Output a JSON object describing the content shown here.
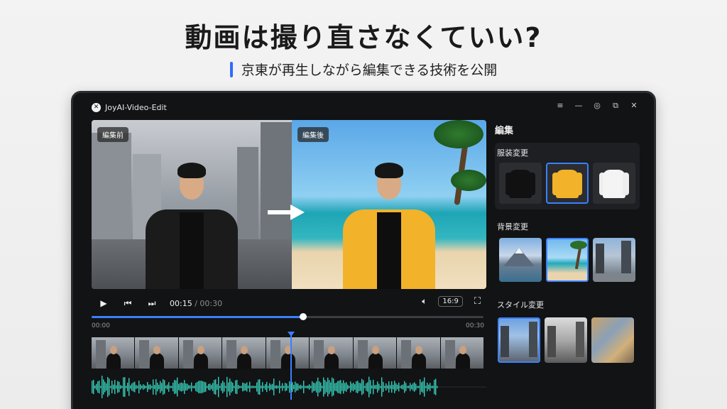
{
  "headline": "動画は撮り直さなくていい?",
  "subheadline": "京東が再生しながら編集できる技術を公開",
  "app": {
    "title": "JoyAI-Video-Edit",
    "logo_glyph": "✕",
    "window_controls": [
      "≡",
      "—",
      "◎",
      "⧉",
      "✕"
    ]
  },
  "preview": {
    "before_label": "編集前",
    "after_label": "編集後"
  },
  "player": {
    "current_time": "00:15",
    "separator": " / ",
    "duration": "00:30",
    "progress_fraction": 0.54,
    "aspect_ratio": "16:9",
    "timeline_start": "00:00",
    "timeline_end": "00:30"
  },
  "sidebar": {
    "title": "編集",
    "sections": [
      {
        "title": "服装変更",
        "options": [
          "black-jacket",
          "yellow-jacket",
          "white-jacket"
        ],
        "selected": 1
      },
      {
        "title": "背景変更",
        "options": [
          "mountain-lake",
          "tropical-beach",
          "city-street"
        ],
        "selected": 1
      },
      {
        "title": "スタイル変更",
        "options": [
          "city-color",
          "city-monochrome",
          "painting-style"
        ],
        "selected": 0
      }
    ]
  },
  "colors": {
    "accent": "#3a80ff",
    "yellow_jacket": "#f2b22a",
    "waveform_start": "#2fc7d9",
    "waveform_end": "#3ad79a"
  }
}
